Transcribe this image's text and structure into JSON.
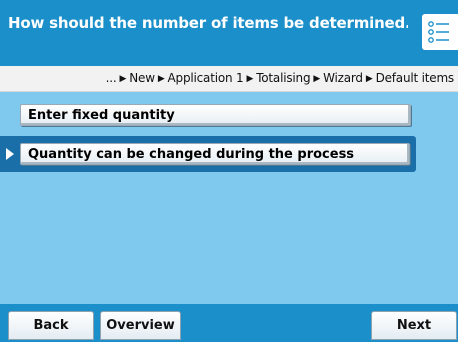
{
  "title": "How should the number of items be determined...",
  "breadcrumb": {
    "lead": "...",
    "items": [
      "New",
      "Application 1",
      "Totalising",
      "Wizard",
      "Default items"
    ]
  },
  "options": [
    {
      "label": "Enter fixed quantity",
      "selected": false
    },
    {
      "label": "Quantity can be changed during the process",
      "selected": true
    }
  ],
  "soft_keys": {
    "back": "Back",
    "overview": "Overview",
    "next": "Next"
  },
  "colors": {
    "header": "#1a8fca",
    "content": "#7fc9ef",
    "selection": "#1a6fa8"
  },
  "icons": {
    "title_list": "list-icon",
    "crumb_separator": "triangle-right-icon",
    "selection_marker": "selection-arrow-icon"
  }
}
